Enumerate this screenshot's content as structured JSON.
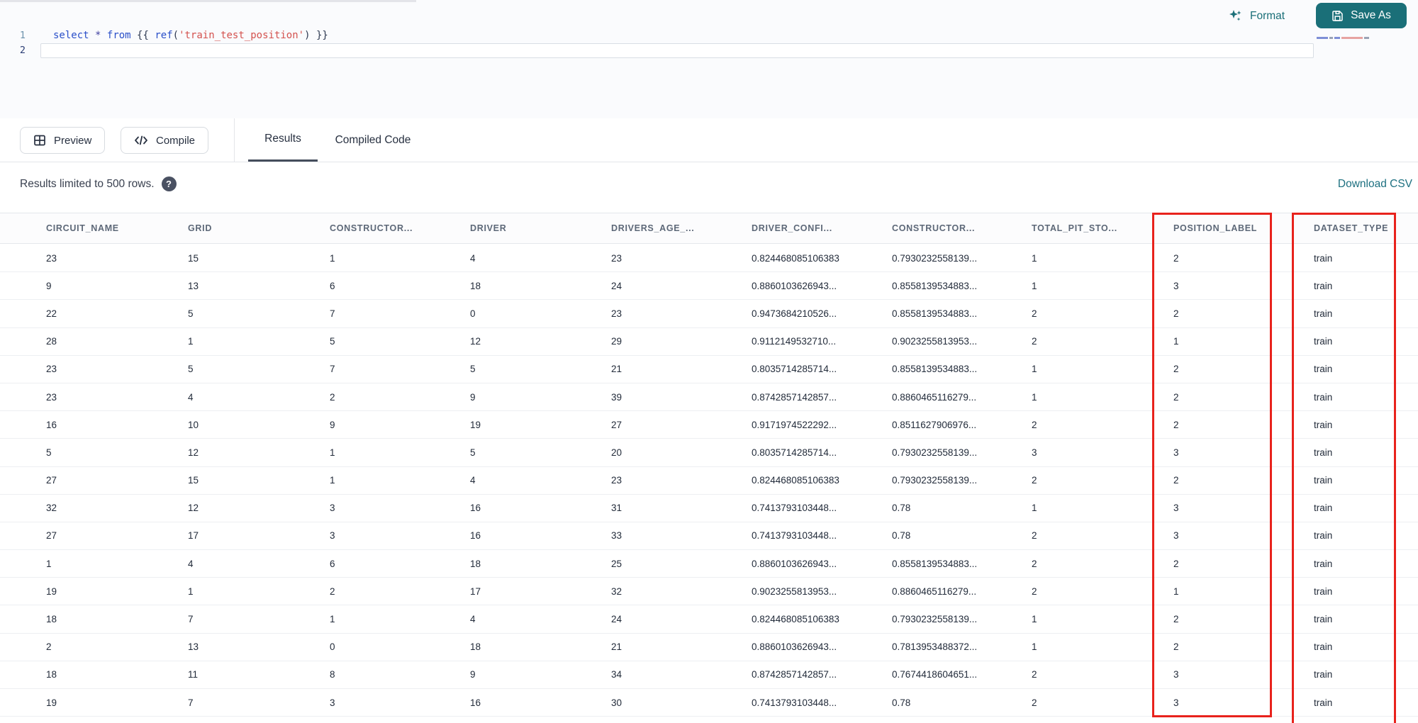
{
  "toolbar": {
    "format_label": "Format",
    "save_as_label": "Save As"
  },
  "editor": {
    "lines": [
      {
        "number": "1",
        "tokens": [
          {
            "t": "select",
            "c": "kw"
          },
          {
            "t": " ",
            "c": "pl"
          },
          {
            "t": "*",
            "c": "op"
          },
          {
            "t": " ",
            "c": "pl"
          },
          {
            "t": "from",
            "c": "kw"
          },
          {
            "t": " ",
            "c": "pl"
          },
          {
            "t": "{{",
            "c": "pu"
          },
          {
            "t": " ",
            "c": "pl"
          },
          {
            "t": "ref",
            "c": "fn"
          },
          {
            "t": "(",
            "c": "pu"
          },
          {
            "t": "'train_test_position'",
            "c": "str"
          },
          {
            "t": ")",
            "c": "pu"
          },
          {
            "t": " ",
            "c": "pl"
          },
          {
            "t": "}}",
            "c": "pu"
          }
        ]
      },
      {
        "number": "2",
        "tokens": []
      }
    ]
  },
  "actions": {
    "preview_label": "Preview",
    "compile_label": "Compile"
  },
  "tabs": [
    {
      "label": "Results",
      "active": true
    },
    {
      "label": "Compiled Code",
      "active": false
    }
  ],
  "results_bar": {
    "message": "Results limited to 500 rows.",
    "help_icon": "?",
    "download_label": "Download CSV"
  },
  "table": {
    "columns": [
      "CIRCUIT_NAME",
      "GRID",
      "CONSTRUCTOR...",
      "DRIVER",
      "DRIVERS_AGE_...",
      "DRIVER_CONFI...",
      "CONSTRUCTOR...",
      "TOTAL_PIT_STO...",
      "POSITION_LABEL",
      "DATASET_TYPE"
    ],
    "rows": [
      [
        "23",
        "15",
        "1",
        "4",
        "23",
        "0.824468085106383",
        "0.7930232558139...",
        "1",
        "2",
        "train"
      ],
      [
        "9",
        "13",
        "6",
        "18",
        "24",
        "0.8860103626943...",
        "0.8558139534883...",
        "1",
        "3",
        "train"
      ],
      [
        "22",
        "5",
        "7",
        "0",
        "23",
        "0.9473684210526...",
        "0.8558139534883...",
        "2",
        "2",
        "train"
      ],
      [
        "28",
        "1",
        "5",
        "12",
        "29",
        "0.9112149532710...",
        "0.9023255813953...",
        "2",
        "1",
        "train"
      ],
      [
        "23",
        "5",
        "7",
        "5",
        "21",
        "0.8035714285714...",
        "0.8558139534883...",
        "1",
        "2",
        "train"
      ],
      [
        "23",
        "4",
        "2",
        "9",
        "39",
        "0.8742857142857...",
        "0.8860465116279...",
        "1",
        "2",
        "train"
      ],
      [
        "16",
        "10",
        "9",
        "19",
        "27",
        "0.9171974522292...",
        "0.8511627906976...",
        "2",
        "2",
        "train"
      ],
      [
        "5",
        "12",
        "1",
        "5",
        "20",
        "0.8035714285714...",
        "0.7930232558139...",
        "3",
        "3",
        "train"
      ],
      [
        "27",
        "15",
        "1",
        "4",
        "23",
        "0.824468085106383",
        "0.7930232558139...",
        "2",
        "2",
        "train"
      ],
      [
        "32",
        "12",
        "3",
        "16",
        "31",
        "0.7413793103448...",
        "0.78",
        "1",
        "3",
        "train"
      ],
      [
        "27",
        "17",
        "3",
        "16",
        "33",
        "0.7413793103448...",
        "0.78",
        "2",
        "3",
        "train"
      ],
      [
        "1",
        "4",
        "6",
        "18",
        "25",
        "0.8860103626943...",
        "0.8558139534883...",
        "2",
        "2",
        "train"
      ],
      [
        "19",
        "1",
        "2",
        "17",
        "32",
        "0.9023255813953...",
        "0.8860465116279...",
        "2",
        "1",
        "train"
      ],
      [
        "18",
        "7",
        "1",
        "4",
        "24",
        "0.824468085106383",
        "0.7930232558139...",
        "1",
        "2",
        "train"
      ],
      [
        "2",
        "13",
        "0",
        "18",
        "21",
        "0.8860103626943...",
        "0.7813953488372...",
        "1",
        "2",
        "train"
      ],
      [
        "18",
        "11",
        "8",
        "9",
        "34",
        "0.8742857142857...",
        "0.7674418604651...",
        "2",
        "3",
        "train"
      ],
      [
        "19",
        "7",
        "3",
        "16",
        "30",
        "0.7413793103448...",
        "0.78",
        "2",
        "3",
        "train"
      ]
    ]
  },
  "annotations": {
    "highlighted_columns": [
      "POSITION_LABEL",
      "DATASET_TYPE"
    ],
    "highlight_color": "#e8221c"
  },
  "colors": {
    "accent_teal": "#1a6f78",
    "annotation_red": "#e8221c"
  }
}
